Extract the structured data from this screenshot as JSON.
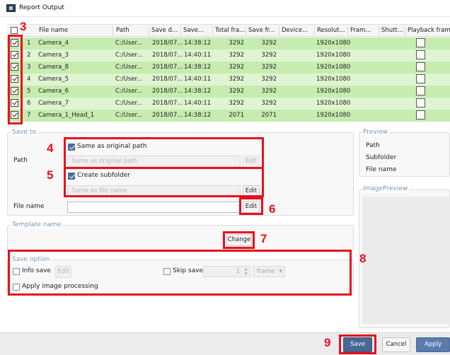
{
  "window": {
    "title": "Report Output"
  },
  "table": {
    "headers": [
      "File name",
      "Path",
      "Save d...",
      "Save...",
      "Total fra...",
      "Save fr...",
      "Device...",
      "Resolut...",
      "Fram...",
      "Shutt...",
      "Playback fram"
    ],
    "rows": [
      {
        "num": "1",
        "name": "Camera_4",
        "path": "C:/User...",
        "date": "2018/07...",
        "time": "14:38:12",
        "total": "3292",
        "saved": "3292",
        "res": "1920x1080"
      },
      {
        "num": "2",
        "name": "Camera_3",
        "path": "C:/User...",
        "date": "2018/07...",
        "time": "14:40:11",
        "total": "3292",
        "saved": "3292",
        "res": "1920x1080"
      },
      {
        "num": "3",
        "name": "Camera_8",
        "path": "C:/User...",
        "date": "2018/07...",
        "time": "14:38:12",
        "total": "3292",
        "saved": "3292",
        "res": "1920x1080"
      },
      {
        "num": "4",
        "name": "Camera_5",
        "path": "C:/User...",
        "date": "2018/07...",
        "time": "14:40:11",
        "total": "3292",
        "saved": "3292",
        "res": "1920x1080"
      },
      {
        "num": "5",
        "name": "Camera_6",
        "path": "C:/User...",
        "date": "2018/07...",
        "time": "14:38:12",
        "total": "3292",
        "saved": "3292",
        "res": "1920x1080"
      },
      {
        "num": "6",
        "name": "Camera_7",
        "path": "C:/User...",
        "date": "2018/07...",
        "time": "14:40:11",
        "total": "3292",
        "saved": "3292",
        "res": "1920x1080"
      },
      {
        "num": "7",
        "name": "Camera_1_Head_1",
        "path": "C:/User...",
        "date": "2018/07...",
        "time": "14:38:12",
        "total": "2071",
        "saved": "2071",
        "res": "1920x1080"
      }
    ]
  },
  "save_to": {
    "title": "Save to",
    "path_label": "Path",
    "same_as_original": "Same as original path",
    "path_placeholder": "Same as original path",
    "edit": "Edit",
    "create_subfolder": "Create subfolder",
    "subfolder_placeholder": "Same as file name",
    "file_name_label": "File name",
    "file_name_value": ""
  },
  "preview": {
    "title": "Preview",
    "path": "Path",
    "subfolder": "Subfolder",
    "file_name": "File name",
    "image_preview": "ImagePreview"
  },
  "template": {
    "title": "Template name",
    "change": "Change"
  },
  "save_option": {
    "title": "Save option",
    "info_save": "Info save",
    "edit": "Edit",
    "skip_save": "Skip save",
    "skip_value": "1",
    "unit": "frame",
    "apply_image_processing": "Apply image processing"
  },
  "buttons": {
    "save": "Save",
    "cancel": "Cancel",
    "apply": "Apply"
  },
  "annotations": {
    "n3": "3",
    "n4": "4",
    "n5": "5",
    "n6": "6",
    "n7": "7",
    "n8": "8",
    "n9": "9"
  },
  "colors": {
    "row_a": "#c6ecb0",
    "row_b": "#dff5d1",
    "highlight": "#e8101d",
    "primary": "#4a6794"
  }
}
